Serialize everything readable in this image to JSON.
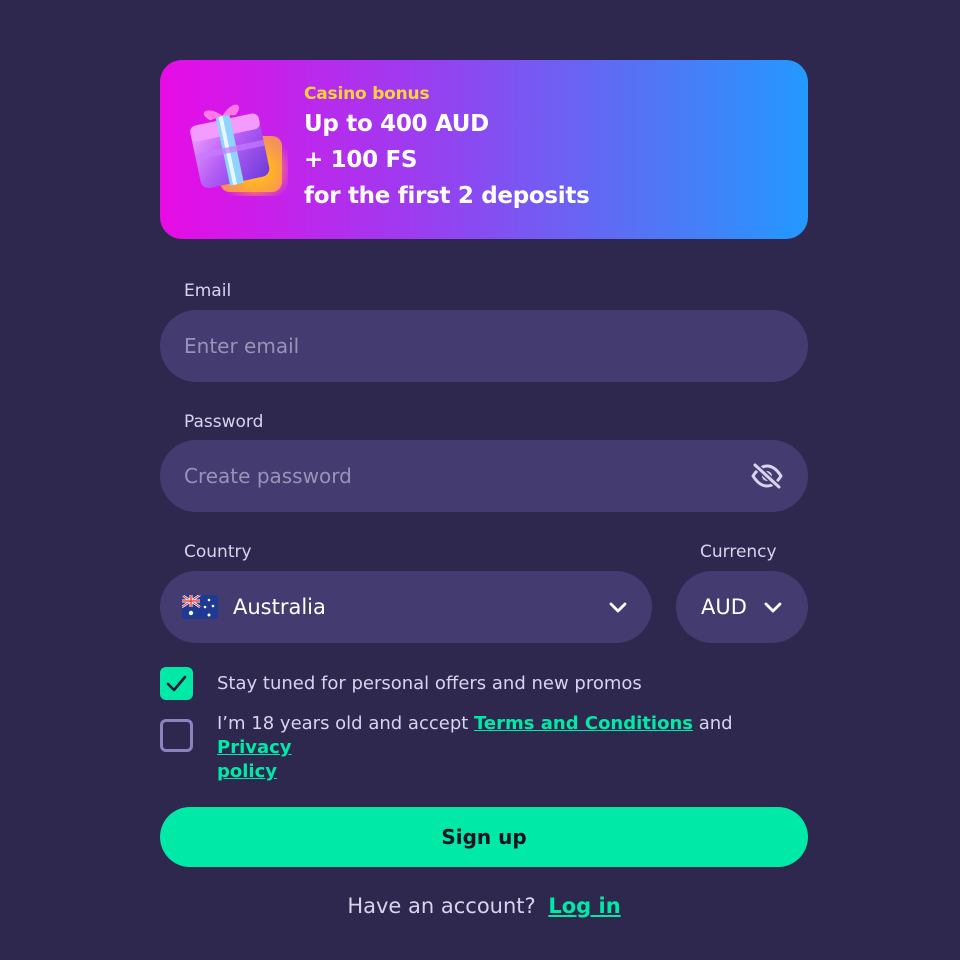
{
  "banner": {
    "kicker": "Casino bonus",
    "line1": "Up to 400 AUD",
    "line2": "+ 100 FS",
    "line3": "for the first 2 deposits",
    "icon": "gift-box-icon"
  },
  "form": {
    "email": {
      "label": "Email",
      "placeholder": "Enter email",
      "value": ""
    },
    "password": {
      "label": "Password",
      "placeholder": "Create password",
      "value": "",
      "toggle_icon": "eye-slash-icon"
    },
    "country": {
      "label": "Country",
      "value": "Australia",
      "flag_icon": "australia-flag-icon"
    },
    "currency": {
      "label": "Currency",
      "value": "AUD"
    },
    "promos_checkbox": {
      "checked": true,
      "label": "Stay tuned for personal offers and new promos"
    },
    "age_checkbox": {
      "checked": false,
      "label_prefix": "I’m 18 years old and accept",
      "terms_link": "Terms and Conditions",
      "and_text": "and",
      "privacy_link_part1": "Privacy",
      "privacy_link_part2": "policy"
    },
    "submit_label": "Sign up"
  },
  "footer": {
    "prompt": "Have an account?",
    "login_link": "Log in"
  },
  "colors": {
    "background": "#2e284f",
    "field": "#443c70",
    "accent": "#00e9a7",
    "bonus_kicker": "#ffd23a",
    "banner_gradient_start": "#e80be6",
    "banner_gradient_end": "#2399ff"
  }
}
